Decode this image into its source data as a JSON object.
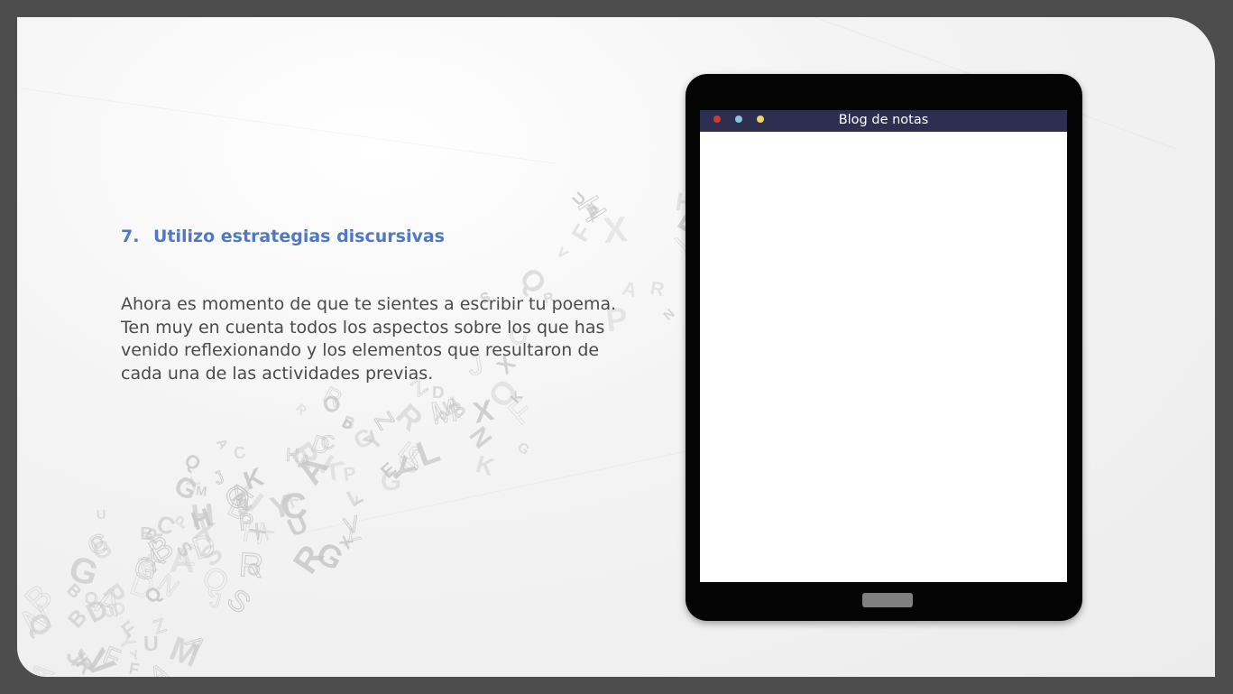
{
  "slide": {
    "heading_number": "7.",
    "heading_text": "Utilizo estrategias discursivas",
    "body_text": "Ahora es momento de que te sientes a escribir tu poema. Ten muy en cuenta todos los aspectos sobre los que has venido reflexionando y los elementos que resultaron de cada una de las actividades previas."
  },
  "tablet": {
    "app_title": "Blog de notas",
    "window_dots": [
      "close-dot",
      "minimize-dot",
      "maximize-dot"
    ],
    "colors": {
      "titlebar": "#2e2f50",
      "dot_red": "#d13a30",
      "dot_blue": "#8fc0e0",
      "dot_yellow": "#f2d268"
    }
  },
  "colors": {
    "heading": "#4f78c8",
    "body": "#4a4a4a",
    "frame": "#4d4d4d"
  }
}
